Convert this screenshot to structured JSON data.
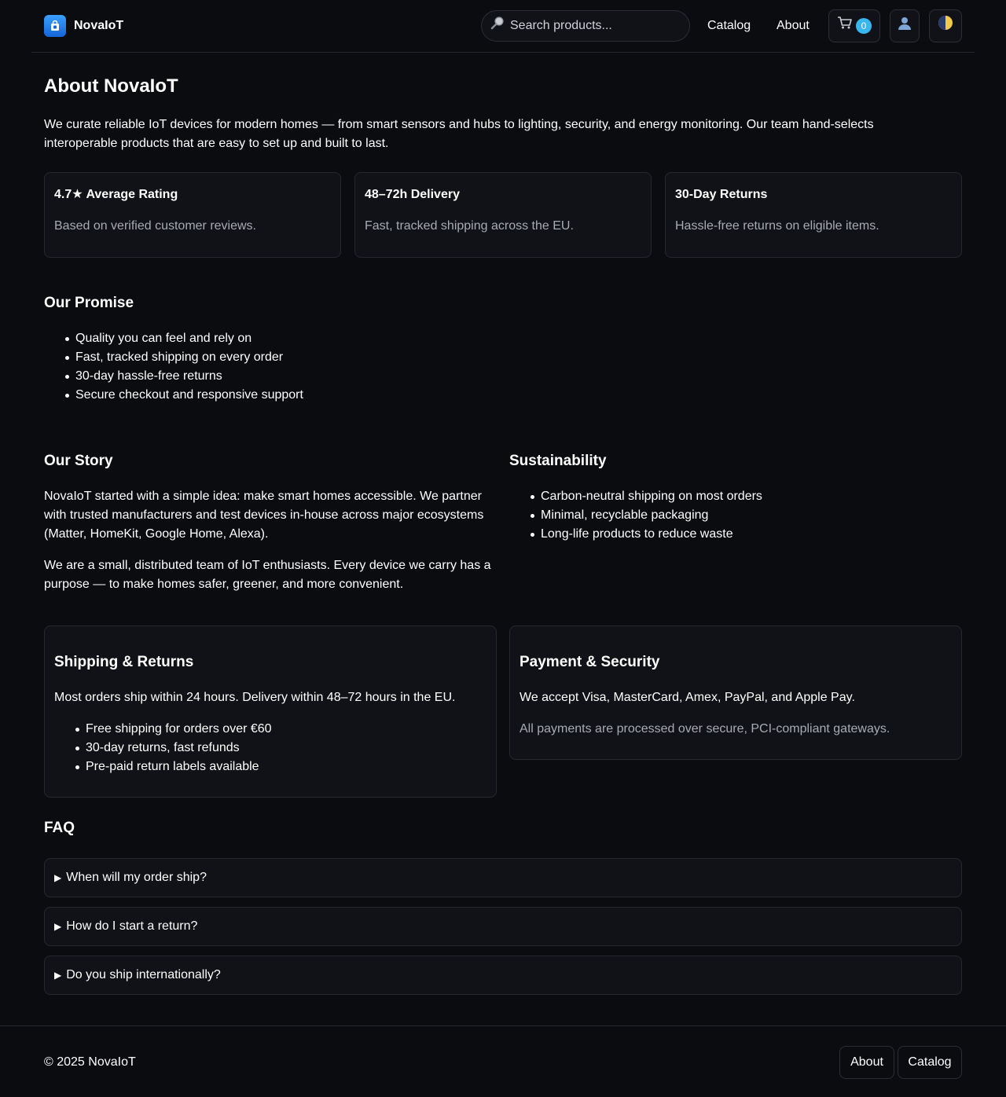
{
  "header": {
    "brand": "NovaIoT",
    "search_placeholder": "Search products...",
    "nav": [
      "Catalog",
      "About"
    ],
    "cart_count": "0"
  },
  "about": {
    "title": "About NovaIoT",
    "intro": "We curate reliable IoT devices for modern homes — from smart sensors and hubs to lighting, security, and energy monitoring. Our team hand-selects interoperable products that are easy to set up and built to last."
  },
  "stats": [
    {
      "title": "4.7★ Average Rating",
      "desc": "Based on verified customer reviews."
    },
    {
      "title": "48–72h Delivery",
      "desc": "Fast, tracked shipping across the EU."
    },
    {
      "title": "30-Day Returns",
      "desc": "Hassle-free returns on eligible items."
    }
  ],
  "promise": {
    "title": "Our Promise",
    "items": [
      "Quality you can feel and rely on",
      "Fast, tracked shipping on every order",
      "30-day hassle-free returns",
      "Secure checkout and responsive support"
    ]
  },
  "story": {
    "title": "Our Story",
    "p1": "NovaIoT started with a simple idea: make smart homes accessible. We partner with trusted manufacturers and test devices in-house across major ecosystems (Matter, HomeKit, Google Home, Alexa).",
    "p2": "We are a small, distributed team of IoT enthusiasts. Every device we carry has a purpose — to make homes safer, greener, and more convenient."
  },
  "sustainability": {
    "title": "Sustainability",
    "items": [
      "Carbon-neutral shipping on most orders",
      "Minimal, recyclable packaging",
      "Long-life products to reduce waste"
    ]
  },
  "shipping": {
    "title": "Shipping & Returns",
    "text": "Most orders ship within 24 hours. Delivery within 48–72 hours in the EU.",
    "items": [
      "Free shipping for orders over €60",
      "30-day returns, fast refunds",
      "Pre-paid return labels available"
    ]
  },
  "payment": {
    "title": "Payment & Security",
    "text": "We accept Visa, MasterCard, Amex, PayPal, and Apple Pay.",
    "note": "All payments are processed over secure, PCI-compliant gateways."
  },
  "faq": {
    "title": "FAQ",
    "items": [
      "When will my order ship?",
      "How do I start a return?",
      "Do you ship internationally?"
    ]
  },
  "footer": {
    "copyright": "© 2025 NovaIoT",
    "links": [
      "About",
      "Catalog"
    ]
  },
  "colors": {
    "background": "#0b0c10",
    "card": "#111217",
    "border": "#262830",
    "accent": "#38b6f0",
    "muted_text": "#a7abb3"
  }
}
